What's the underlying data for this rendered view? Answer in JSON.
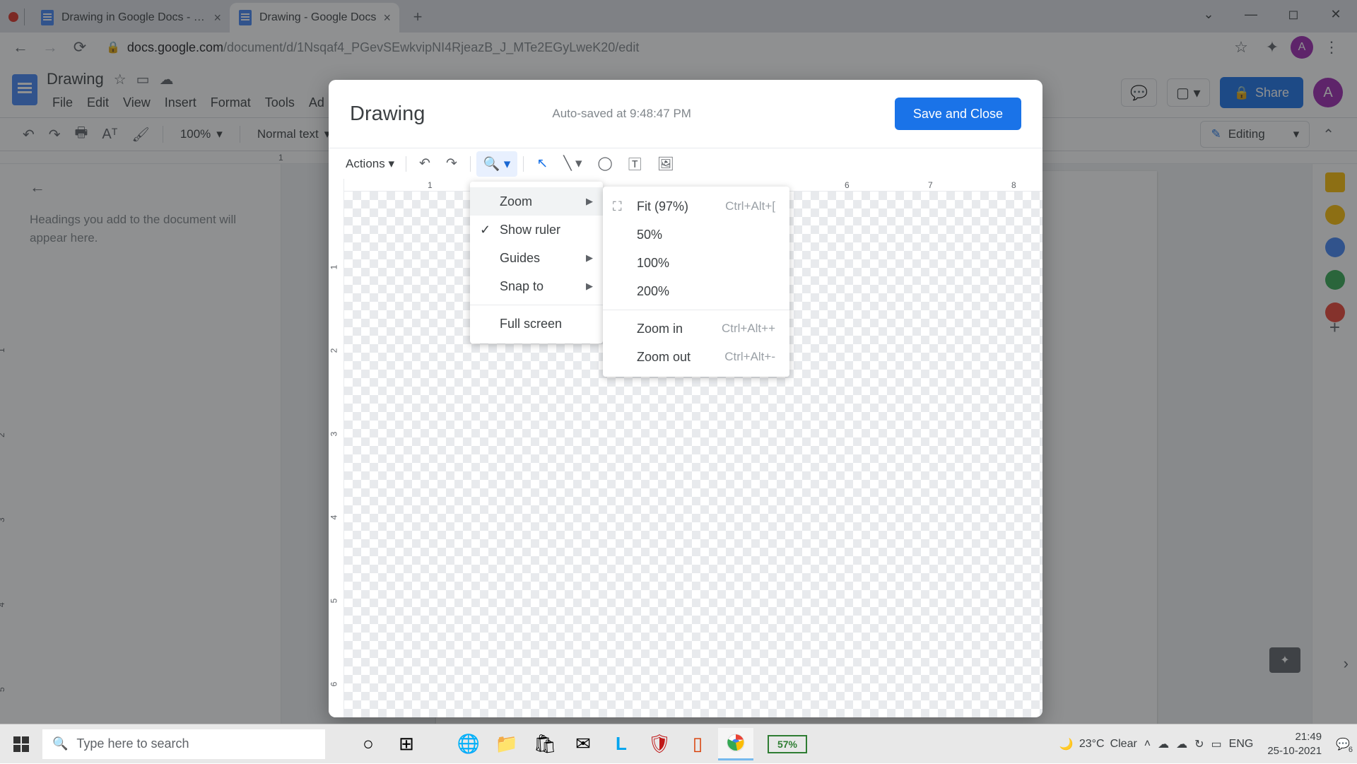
{
  "browser": {
    "tabs": [
      {
        "title": "Drawing in Google Docs - Googl",
        "active": false
      },
      {
        "title": "Drawing - Google Docs",
        "active": true
      }
    ],
    "url_host": "docs.google.com",
    "url_path": "/document/d/1Nsqaf4_PGevSEwkvipNI4RjeazB_J_MTe2EGyLweK20/edit",
    "avatar_letter": "A"
  },
  "docs": {
    "title": "Drawing",
    "menus": [
      "File",
      "Edit",
      "View",
      "Insert",
      "Format",
      "Tools",
      "Ad"
    ],
    "share_label": "Share",
    "comments_label": "Comments",
    "editing_label": "Editing",
    "zoom_display": "100%",
    "style_display": "Normal text",
    "outline_hint": "Headings you add to the document will appear here.",
    "avatar_letter": "A",
    "h_ruler_marks": [
      "1"
    ],
    "v_ruler_marks": [
      "1",
      "2",
      "3",
      "4",
      "5"
    ]
  },
  "modal": {
    "title": "Drawing",
    "status": "Auto-saved at 9:48:47 PM",
    "save_label": "Save and Close",
    "actions_label": "Actions",
    "h_ruler": [
      "1",
      "6",
      "7",
      "8"
    ],
    "v_ruler": [
      "1",
      "2",
      "3",
      "4",
      "5",
      "6"
    ]
  },
  "zoom_menu": {
    "items": [
      {
        "label": "Zoom",
        "arrow": true,
        "highlighted": true,
        "checked": false
      },
      {
        "label": "Show ruler",
        "arrow": false,
        "highlighted": false,
        "checked": true
      },
      {
        "label": "Guides",
        "arrow": true,
        "highlighted": false,
        "checked": false
      },
      {
        "label": "Snap to",
        "arrow": true,
        "highlighted": false,
        "checked": false
      }
    ],
    "footer": "Full screen"
  },
  "zoom_submenu": {
    "fit_label": "Fit (97%)",
    "fit_shortcut": "Ctrl+Alt+[",
    "levels": [
      "50%",
      "100%",
      "200%"
    ],
    "zoom_in": {
      "label": "Zoom in",
      "shortcut": "Ctrl+Alt++"
    },
    "zoom_out": {
      "label": "Zoom out",
      "shortcut": "Ctrl+Alt+-"
    }
  },
  "taskbar": {
    "search_placeholder": "Type here to search",
    "battery": "57%",
    "weather_temp": "23°C",
    "weather_cond": "Clear",
    "lang": "ENG",
    "time": "21:49",
    "date": "25-10-2021",
    "notif_count": "6"
  }
}
